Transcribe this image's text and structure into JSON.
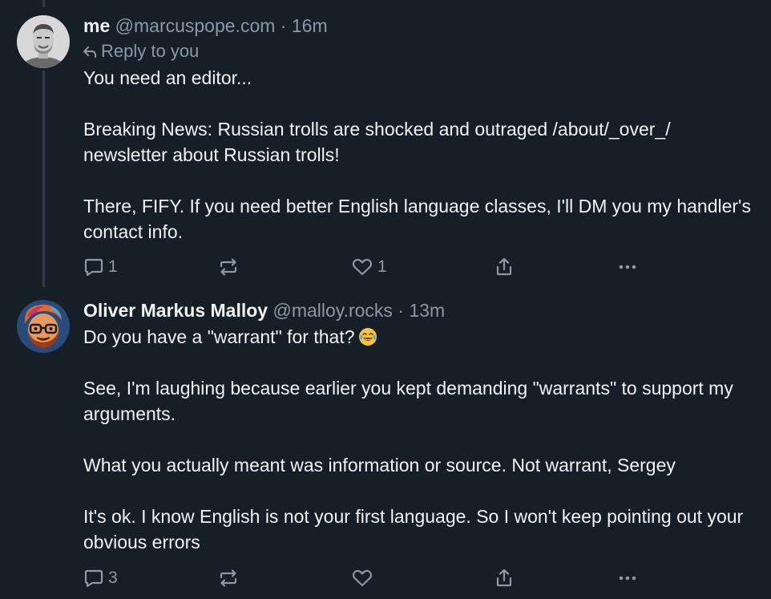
{
  "posts": [
    {
      "author_name": "me",
      "handle": "@marcuspope.com",
      "separator": "·",
      "time": "16m",
      "reply_to": "Reply to you",
      "paragraphs": [
        "You need an editor...",
        "Breaking News: Russian trolls are shocked and outraged /about/_over_/ newsletter about Russian trolls!",
        "There, FIFY.  If you need better English language classes, I'll DM you my handler's contact info."
      ],
      "actions": {
        "reply_count": "1",
        "repost_count": "",
        "like_count": "1"
      },
      "avatar_icon": "avatar-man-photo"
    },
    {
      "author_name": "Oliver Markus Malloy",
      "handle": "@malloy.rocks",
      "separator": "·",
      "time": "13m",
      "paragraphs": [
        "Do you have a \"warrant\" for that?",
        "See, I'm laughing because earlier you kept demanding \"warrants\" to support my arguments.",
        "What you actually meant was information or source. Not warrant, Sergey",
        "It's ok. I know English is not your first language. So I won't keep pointing out your obvious errors"
      ],
      "emoji": "face-with-tears-of-joy",
      "actions": {
        "reply_count": "3",
        "repost_count": "",
        "like_count": ""
      },
      "avatar_icon": "avatar-cartoon-man"
    }
  ],
  "colors": {
    "background": "#161e27",
    "text_primary": "#f1f3f5",
    "text_secondary": "#8a99a8",
    "thread_line": "#2e3d4e"
  }
}
